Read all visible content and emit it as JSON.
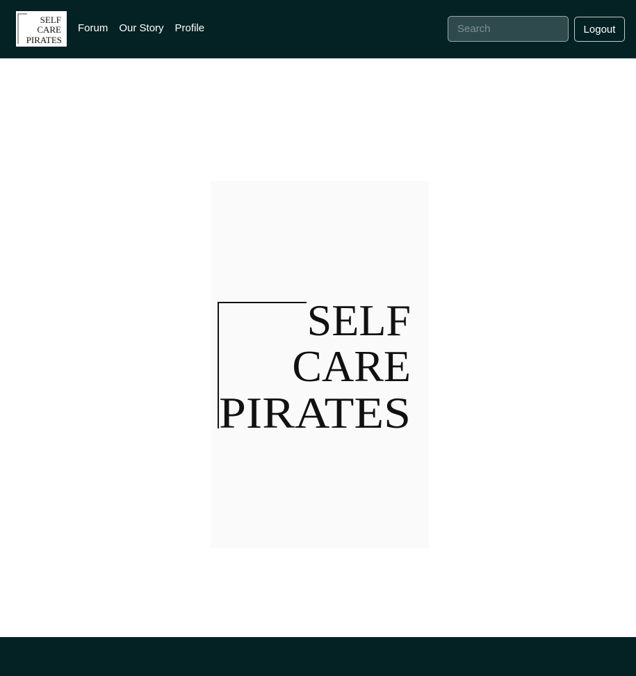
{
  "navbar": {
    "brand_logo": {
      "line1": "SELF",
      "line2": "CARE",
      "line3": "PIRATES"
    },
    "links": [
      {
        "label": "Forum"
      },
      {
        "label": "Our Story"
      },
      {
        "label": "Profile"
      }
    ],
    "search": {
      "placeholder": "Search",
      "value": ""
    },
    "logout_label": "Logout"
  },
  "hero": {
    "logo": {
      "line1": "SELF",
      "line2": "CARE",
      "line3": "PIRATES"
    }
  },
  "colors": {
    "navbar_background": "#042224",
    "footer_background": "#042224",
    "search_background": "#2f4a4d",
    "page_background": "#ffffff",
    "logo_ink": "#111111"
  }
}
